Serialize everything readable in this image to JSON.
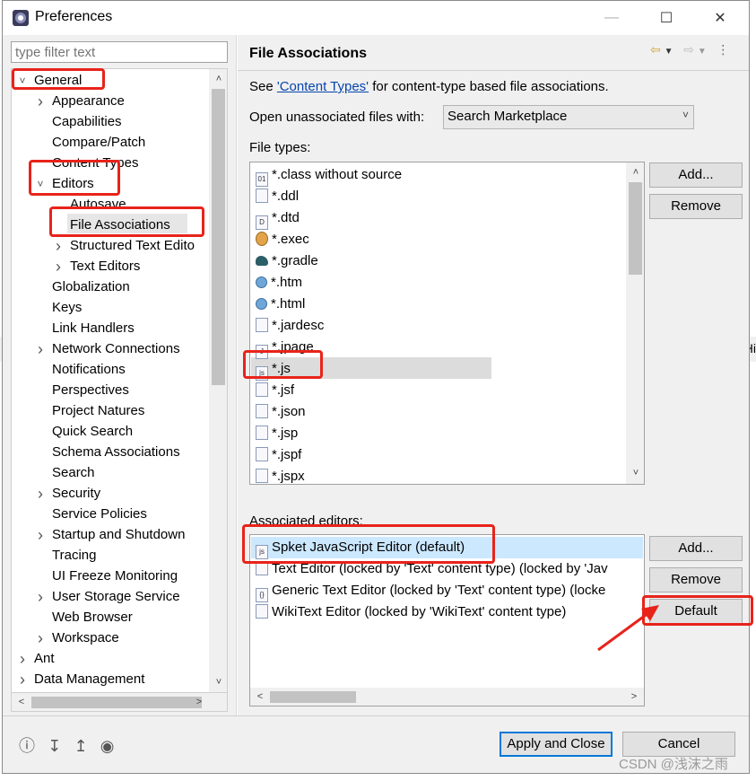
{
  "window": {
    "title": "Preferences"
  },
  "filter": {
    "placeholder": "type filter text"
  },
  "tree": [
    {
      "label": "General",
      "arrow": "expanded",
      "level": 0
    },
    {
      "label": "Appearance",
      "arrow": "collapsed",
      "level": 1
    },
    {
      "label": "Capabilities",
      "arrow": "none",
      "level": 1
    },
    {
      "label": "Compare/Patch",
      "arrow": "none",
      "level": 1
    },
    {
      "label": "Content Types",
      "arrow": "none",
      "level": 1
    },
    {
      "label": "Editors",
      "arrow": "expanded",
      "level": 1
    },
    {
      "label": "Autosave",
      "arrow": "none",
      "level": 2
    },
    {
      "label": "File Associations",
      "arrow": "none",
      "level": 2
    },
    {
      "label": "Structured Text Edito",
      "arrow": "collapsed",
      "level": 2
    },
    {
      "label": "Text Editors",
      "arrow": "collapsed",
      "level": 2
    },
    {
      "label": "Globalization",
      "arrow": "none",
      "level": 1
    },
    {
      "label": "Keys",
      "arrow": "none",
      "level": 1
    },
    {
      "label": "Link Handlers",
      "arrow": "none",
      "level": 1
    },
    {
      "label": "Network Connections",
      "arrow": "collapsed",
      "level": 1
    },
    {
      "label": "Notifications",
      "arrow": "none",
      "level": 1
    },
    {
      "label": "Perspectives",
      "arrow": "none",
      "level": 1
    },
    {
      "label": "Project Natures",
      "arrow": "none",
      "level": 1
    },
    {
      "label": "Quick Search",
      "arrow": "none",
      "level": 1
    },
    {
      "label": "Schema Associations",
      "arrow": "none",
      "level": 1
    },
    {
      "label": "Search",
      "arrow": "none",
      "level": 1
    },
    {
      "label": "Security",
      "arrow": "collapsed",
      "level": 1
    },
    {
      "label": "Service Policies",
      "arrow": "none",
      "level": 1
    },
    {
      "label": "Startup and Shutdown",
      "arrow": "collapsed",
      "level": 1
    },
    {
      "label": "Tracing",
      "arrow": "none",
      "level": 1
    },
    {
      "label": "UI Freeze Monitoring",
      "arrow": "none",
      "level": 1
    },
    {
      "label": "User Storage Service",
      "arrow": "collapsed",
      "level": 1
    },
    {
      "label": "Web Browser",
      "arrow": "none",
      "level": 1
    },
    {
      "label": "Workspace",
      "arrow": "collapsed",
      "level": 1
    },
    {
      "label": "Ant",
      "arrow": "collapsed",
      "level": 0
    },
    {
      "label": "Data Management",
      "arrow": "collapsed",
      "level": 0
    }
  ],
  "page": {
    "title": "File Associations",
    "see_prefix": "See ",
    "see_link": "'Content Types'",
    "see_suffix": " for content-type based file associations.",
    "open_label": "Open unassociated files with:",
    "open_value": "Search Marketplace",
    "file_types_label": "File types:",
    "associated_label": "Associated editors:"
  },
  "file_types": [
    {
      "name": "*.class without source",
      "icon": "class-file-icon"
    },
    {
      "name": "*.ddl",
      "icon": "ddl-file-icon"
    },
    {
      "name": "*.dtd",
      "icon": "dtd-file-icon"
    },
    {
      "name": "*.exec",
      "icon": "exec-file-icon"
    },
    {
      "name": "*.gradle",
      "icon": "gradle-file-icon"
    },
    {
      "name": "*.htm",
      "icon": "globe-file-icon"
    },
    {
      "name": "*.html",
      "icon": "globe-file-icon"
    },
    {
      "name": "*.jardesc",
      "icon": "jardesc-file-icon"
    },
    {
      "name": "*.jpage",
      "icon": "jpage-file-icon"
    },
    {
      "name": "*.js",
      "icon": "js-file-icon"
    },
    {
      "name": "*.jsf",
      "icon": "jsf-file-icon"
    },
    {
      "name": "*.json",
      "icon": "json-file-icon"
    },
    {
      "name": "*.jsp",
      "icon": "jsp-file-icon"
    },
    {
      "name": "*.jspf",
      "icon": "jspf-file-icon"
    },
    {
      "name": "*.jspx",
      "icon": "jspx-file-icon"
    }
  ],
  "file_type_buttons": {
    "add": "Add...",
    "remove": "Remove"
  },
  "editors": [
    {
      "name": "Spket JavaScript Editor (default)",
      "icon": "js-editor-icon"
    },
    {
      "name": "Text Editor (locked by 'Text' content type) (locked by 'Jav",
      "icon": "text-editor-icon"
    },
    {
      "name": "Generic Text Editor (locked by 'Text' content type) (locke",
      "icon": "generic-editor-icon"
    },
    {
      "name": "WikiText Editor (locked by 'WikiText' content type)",
      "icon": "wikitext-editor-icon"
    }
  ],
  "editor_buttons": {
    "add": "Add...",
    "remove": "Remove",
    "default": "Default"
  },
  "footer": {
    "apply_close": "Apply and Close",
    "cancel": "Cancel"
  },
  "watermark": "CSDN @浅沫之雨",
  "background": {
    "left_text": "",
    "right_text": "Hi"
  },
  "colors": {
    "annotation": "#e8231a",
    "selection": "#cce8ff",
    "link": "#0645ad"
  }
}
